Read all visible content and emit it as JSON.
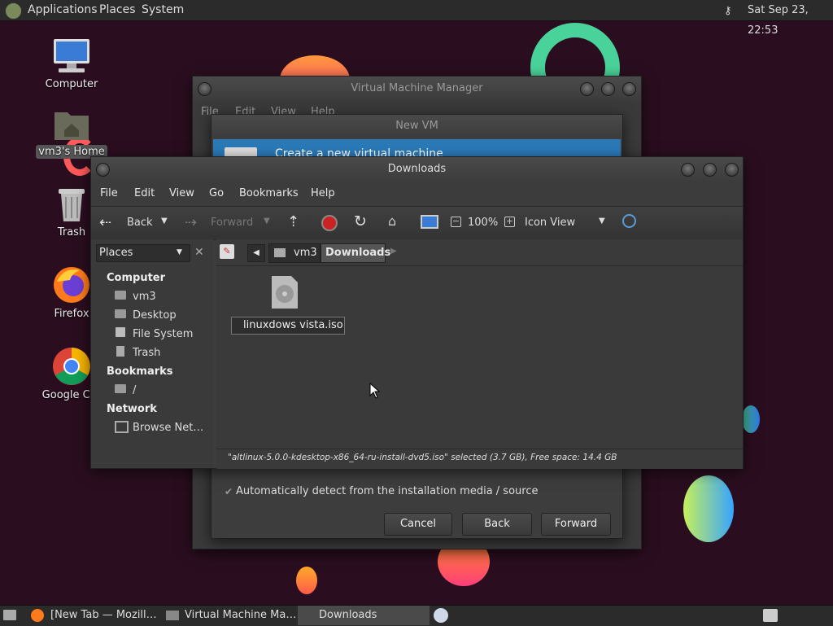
{
  "top_panel": {
    "menus": [
      "Applications",
      "Places",
      "System"
    ],
    "clock": "Sat Sep 23, 22:53"
  },
  "desktop_icons": [
    {
      "label": "Computer",
      "icon": "computer-icon"
    },
    {
      "label": "vm3's Home",
      "icon": "home-folder-icon"
    },
    {
      "label": "Trash",
      "icon": "trash-icon"
    },
    {
      "label": "Firefox",
      "icon": "firefox-icon"
    },
    {
      "label": "Google Chr",
      "icon": "chrome-icon"
    }
  ],
  "vmm_window": {
    "title": "Virtual Machine Manager",
    "menus": [
      "File",
      "Edit",
      "View",
      "Help"
    ]
  },
  "newvm_dialog": {
    "title": "New VM",
    "header": "Create a new virtual machine",
    "autodetect_label": "Automatically detect from the installation media / source",
    "buttons": {
      "cancel": "Cancel",
      "back": "Back",
      "forward": "Forward"
    }
  },
  "downloads_window": {
    "title": "Downloads",
    "menus": [
      "File",
      "Edit",
      "View",
      "Go",
      "Bookmarks",
      "Help"
    ],
    "toolbar": {
      "back": "Back",
      "forward": "Forward",
      "zoom": "100%",
      "view_mode": "Icon View"
    },
    "sidebar": {
      "selector": "Places",
      "sections": [
        {
          "heading": "Computer",
          "items": [
            "vm3",
            "Desktop",
            "File System",
            "Trash"
          ]
        },
        {
          "heading": "Bookmarks",
          "items": [
            "/"
          ]
        },
        {
          "heading": "Network",
          "items": [
            "Browse Net…"
          ]
        }
      ]
    },
    "path": [
      "vm3",
      "Downloads"
    ],
    "files": [
      {
        "name": "linuxdows vista.iso",
        "icon": "disc-image-icon",
        "renaming": true
      }
    ],
    "status": "\"altlinux-5.0.0-kdesktop-x86_64-ru-install-dvd5.iso\" selected (3.7 GB), Free space: 14.4 GB"
  },
  "taskbar": {
    "tasks": [
      "[New Tab — Mozill…",
      "Virtual Machine Ma…",
      "Downloads"
    ]
  },
  "colors": {
    "desktop_bg": "#2a0e1f",
    "selection_blue": "#2a7ab8",
    "panel": "#2b2b2b"
  }
}
